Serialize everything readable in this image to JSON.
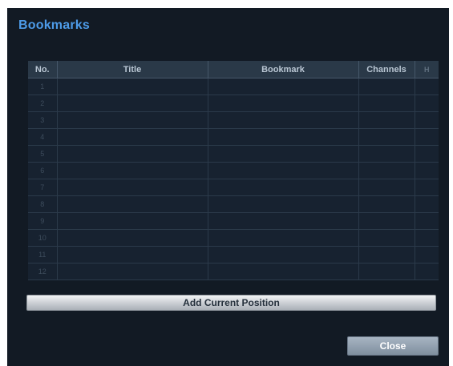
{
  "dialog": {
    "title": "Bookmarks",
    "add_button_label": "Add Current Position",
    "close_button_label": "Close"
  },
  "table": {
    "columns": [
      "No.",
      "Title",
      "Bookmark",
      "Channels",
      "H"
    ],
    "rows": [
      {
        "no": "1"
      },
      {
        "no": "2"
      },
      {
        "no": "3"
      },
      {
        "no": "4"
      },
      {
        "no": "5"
      },
      {
        "no": "6"
      },
      {
        "no": "7"
      },
      {
        "no": "8"
      },
      {
        "no": "9"
      },
      {
        "no": "10"
      },
      {
        "no": "11"
      },
      {
        "no": "12"
      }
    ]
  },
  "colors": {
    "title_accent": "#4d9be8",
    "dialog_bg": "#121a24",
    "header_bg": "#2a3948"
  }
}
